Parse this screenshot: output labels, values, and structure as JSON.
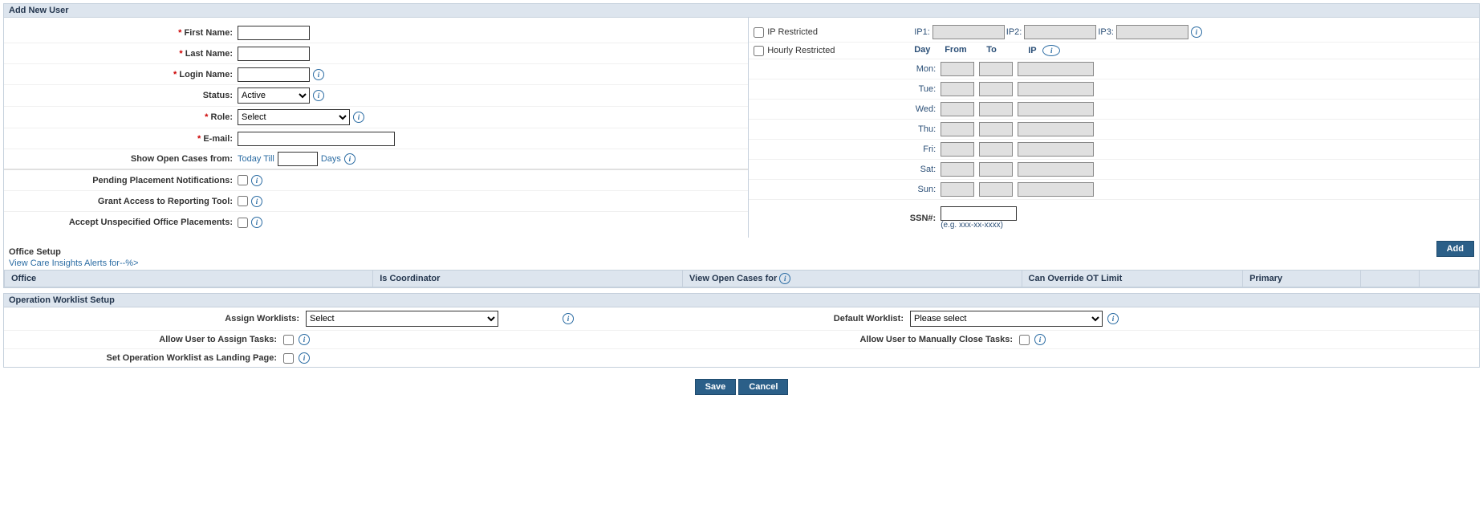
{
  "panels": {
    "addUser": "Add New User",
    "officeSetup": "Office Setup",
    "opWorklist": "Operation Worklist Setup"
  },
  "left": {
    "firstName": "First Name:",
    "lastName": "Last Name:",
    "loginName": "Login Name:",
    "status": "Status:",
    "statusValue": "Active",
    "role": "Role:",
    "roleValue": "Select",
    "email": "E-mail:",
    "showOpenCases": "Show Open Cases from:",
    "todayTill": "Today Till",
    "days": "Days",
    "pendingPlacement": "Pending Placement Notifications:",
    "grantReporting": "Grant Access to Reporting Tool:",
    "acceptUnspecified": "Accept Unspecified Office Placements:"
  },
  "right": {
    "ipRestricted": "IP Restricted",
    "hourlyRestricted": "Hourly Restricted",
    "ip1": "IP1:",
    "ip2": "IP2:",
    "ip3": "IP3:",
    "dayHdr": "Day",
    "fromHdr": "From",
    "toHdr": "To",
    "ipHdr": "IP",
    "days": [
      "Mon:",
      "Tue:",
      "Wed:",
      "Thu:",
      "Fri:",
      "Sat:",
      "Sun:"
    ],
    "ssn": "SSN#:",
    "ssnHint": "(e.g. xxx-xx-xxxx)"
  },
  "office": {
    "careLink": "View Care Insights Alerts for--%>",
    "addBtn": "Add",
    "cols": [
      "Office",
      "Is Coordinator",
      "View Open Cases for ",
      "Can Override OT Limit",
      "Primary",
      "",
      ""
    ]
  },
  "worklist": {
    "assign": "Assign Worklists:",
    "assignValue": "Select",
    "default": "Default Worklist:",
    "defaultValue": "Please select",
    "allowAssign": "Allow User to Assign Tasks:",
    "allowClose": "Allow User to Manually Close Tasks:",
    "landing": "Set Operation Worklist as Landing Page:"
  },
  "buttons": {
    "save": "Save",
    "cancel": "Cancel"
  }
}
